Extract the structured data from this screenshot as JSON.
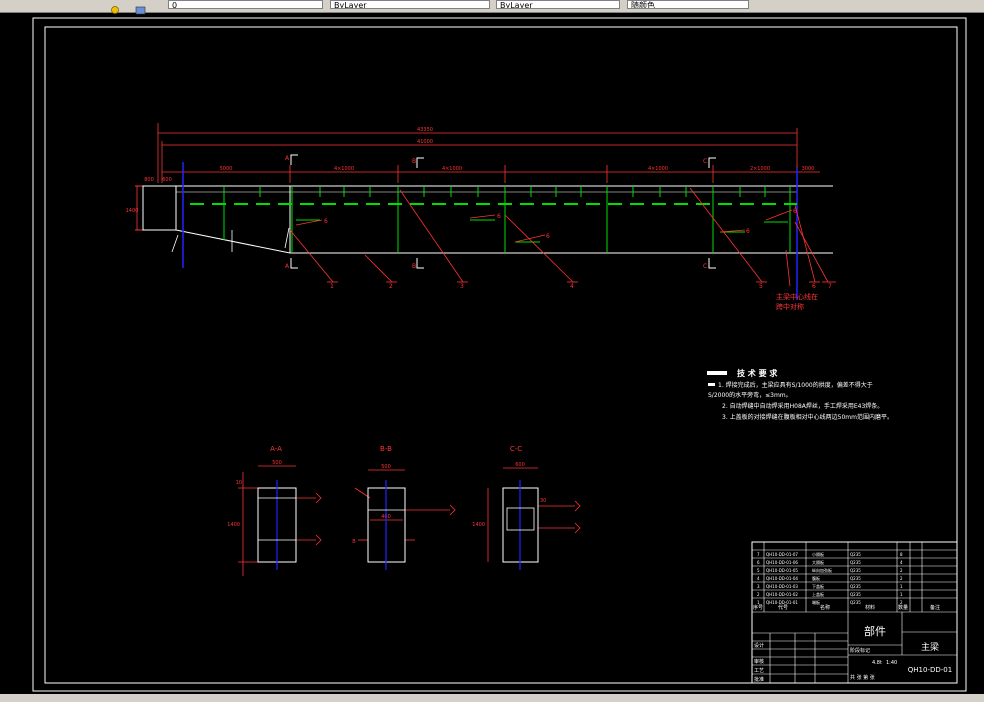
{
  "toolbar": {
    "layer_field": "0",
    "linetype_field": "ByLayer",
    "lineweight_field": "ByLayer",
    "plot_field": "随颜色"
  },
  "drawing": {
    "colors": {
      "frame": "#ffffff",
      "dimension": "#ff3333",
      "structure": "#ffffff",
      "stiffener": "#00dd00",
      "centerline": "#2222ff"
    },
    "dims": {
      "overall": "43350",
      "overall_inner": "41000",
      "seg1": "5000",
      "seg2": "4×1000",
      "seg3": "4×1000",
      "seg4": "4×1000",
      "seg5": "2×1000",
      "seg_end": "3000",
      "left_a": "800",
      "left_b": "600",
      "height": "1400"
    },
    "section_marks": [
      "A",
      "A",
      "B",
      "B",
      "C",
      "C"
    ],
    "callouts": [
      "1",
      "2",
      "3",
      "4",
      "5",
      "6",
      "7"
    ],
    "weld_labels": [
      "6",
      "6",
      "6",
      "6",
      "6"
    ],
    "note_red_line1": "主梁中心线在",
    "note_red_line2": "跨中对称",
    "tech_req": {
      "title": "技 术 要 求",
      "line1": "1. 焊接完成后，主梁应具有S/1000的拱度，偏差不得大于",
      "line2": "S/2000的水平旁弯，≤3mm。",
      "line3": "2. 自动焊缝中自动焊采用H08A焊丝，手工焊采用E43焊条。",
      "line4": "3. 上盖板的对接焊缝在腹板相对中心线两边50mm范围内磨平。"
    },
    "sections": {
      "aa": {
        "title": "A-A",
        "w": "500",
        "h": "1400",
        "t": "10"
      },
      "bb": {
        "title": "B-B",
        "w": "500",
        "h": "1400",
        "dim": "460",
        "side": "B"
      },
      "cc": {
        "title": "C-C",
        "w": "600",
        "h": "1400",
        "t": "30"
      }
    },
    "title_block": {
      "part": "部件",
      "name": "主梁",
      "code": "QH10-DD-01",
      "scale": "1:40",
      "weight": "4.8t",
      "col_no": "序号",
      "col_code": "代号",
      "col_name": "名称",
      "col_qty": "数量",
      "col_mat": "材料",
      "col_note": "备注",
      "row_design": "设计",
      "row_check": "审核",
      "row_process": "工艺",
      "row_approve": "批准",
      "row_stage": "阶段标记",
      "row_sheet": "共 张 第 张",
      "bom": [
        {
          "no": "7",
          "code": "QH10-DD-01-07",
          "name": "小隔板",
          "qty": "8",
          "mat": "Q235"
        },
        {
          "no": "6",
          "code": "QH10-DD-01-06",
          "name": "大隔板",
          "qty": "4",
          "mat": "Q235"
        },
        {
          "no": "5",
          "code": "QH10-DD-01-05",
          "name": "纵向加劲板",
          "qty": "2",
          "mat": "Q235"
        },
        {
          "no": "4",
          "code": "QH10-DD-01-04",
          "name": "腹板",
          "qty": "2",
          "mat": "Q235"
        },
        {
          "no": "3",
          "code": "QH10-DD-01-03",
          "name": "下盖板",
          "qty": "1",
          "mat": "Q235"
        },
        {
          "no": "2",
          "code": "QH10-DD-01-02",
          "name": "上盖板",
          "qty": "1",
          "mat": "Q235"
        },
        {
          "no": "1",
          "code": "QH10-DD-01-01",
          "name": "端板",
          "qty": "2",
          "mat": "Q235"
        }
      ]
    }
  }
}
